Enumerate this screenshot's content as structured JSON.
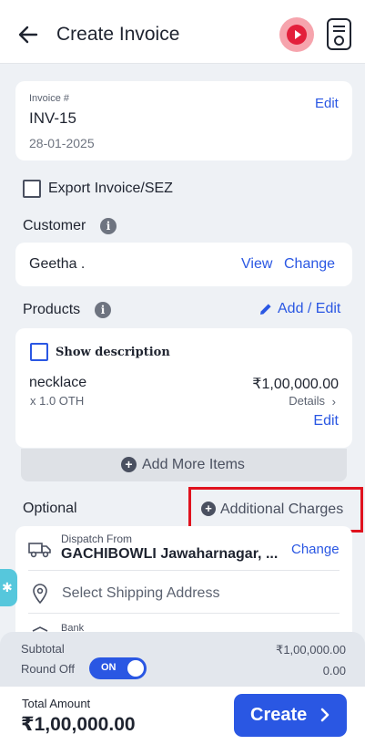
{
  "header": {
    "title": "Create Invoice"
  },
  "invoice": {
    "label": "Invoice #",
    "number": "INV-15",
    "date": "28-01-2025",
    "edit": "Edit"
  },
  "export": {
    "label": "Export Invoice/SEZ"
  },
  "customer": {
    "title": "Customer",
    "name": "Geetha .",
    "view": "View",
    "change": "Change"
  },
  "products": {
    "title": "Products",
    "add_edit": "Add / Edit",
    "show_description": "Show description",
    "item": {
      "name": "necklace",
      "price": "₹1,00,000.00",
      "qty": "x 1.0 OTH",
      "details": "Details",
      "edit": "Edit"
    },
    "add_more": "Add More Items"
  },
  "optional": {
    "title": "Optional",
    "additional_charges": "Additional Charges"
  },
  "shipping": {
    "dispatch_label": "Dispatch From",
    "dispatch_value": "GACHIBOWLI Jawaharnagar, ...",
    "change": "Change",
    "ship_placeholder": "Select Shipping Address",
    "bank_label": "Bank"
  },
  "totals": {
    "subtotal_label": "Subtotal",
    "subtotal_value": "₹1,00,000.00",
    "roundoff_label": "Round Off",
    "roundoff_toggle": "ON",
    "roundoff_value": "0.00"
  },
  "footer": {
    "total_label": "Total Amount",
    "total_value": "₹1,00,000.00",
    "create": "Create"
  },
  "colors": {
    "accent": "#2a57e3",
    "highlight": "#e0121e",
    "play": "#e3203b"
  }
}
